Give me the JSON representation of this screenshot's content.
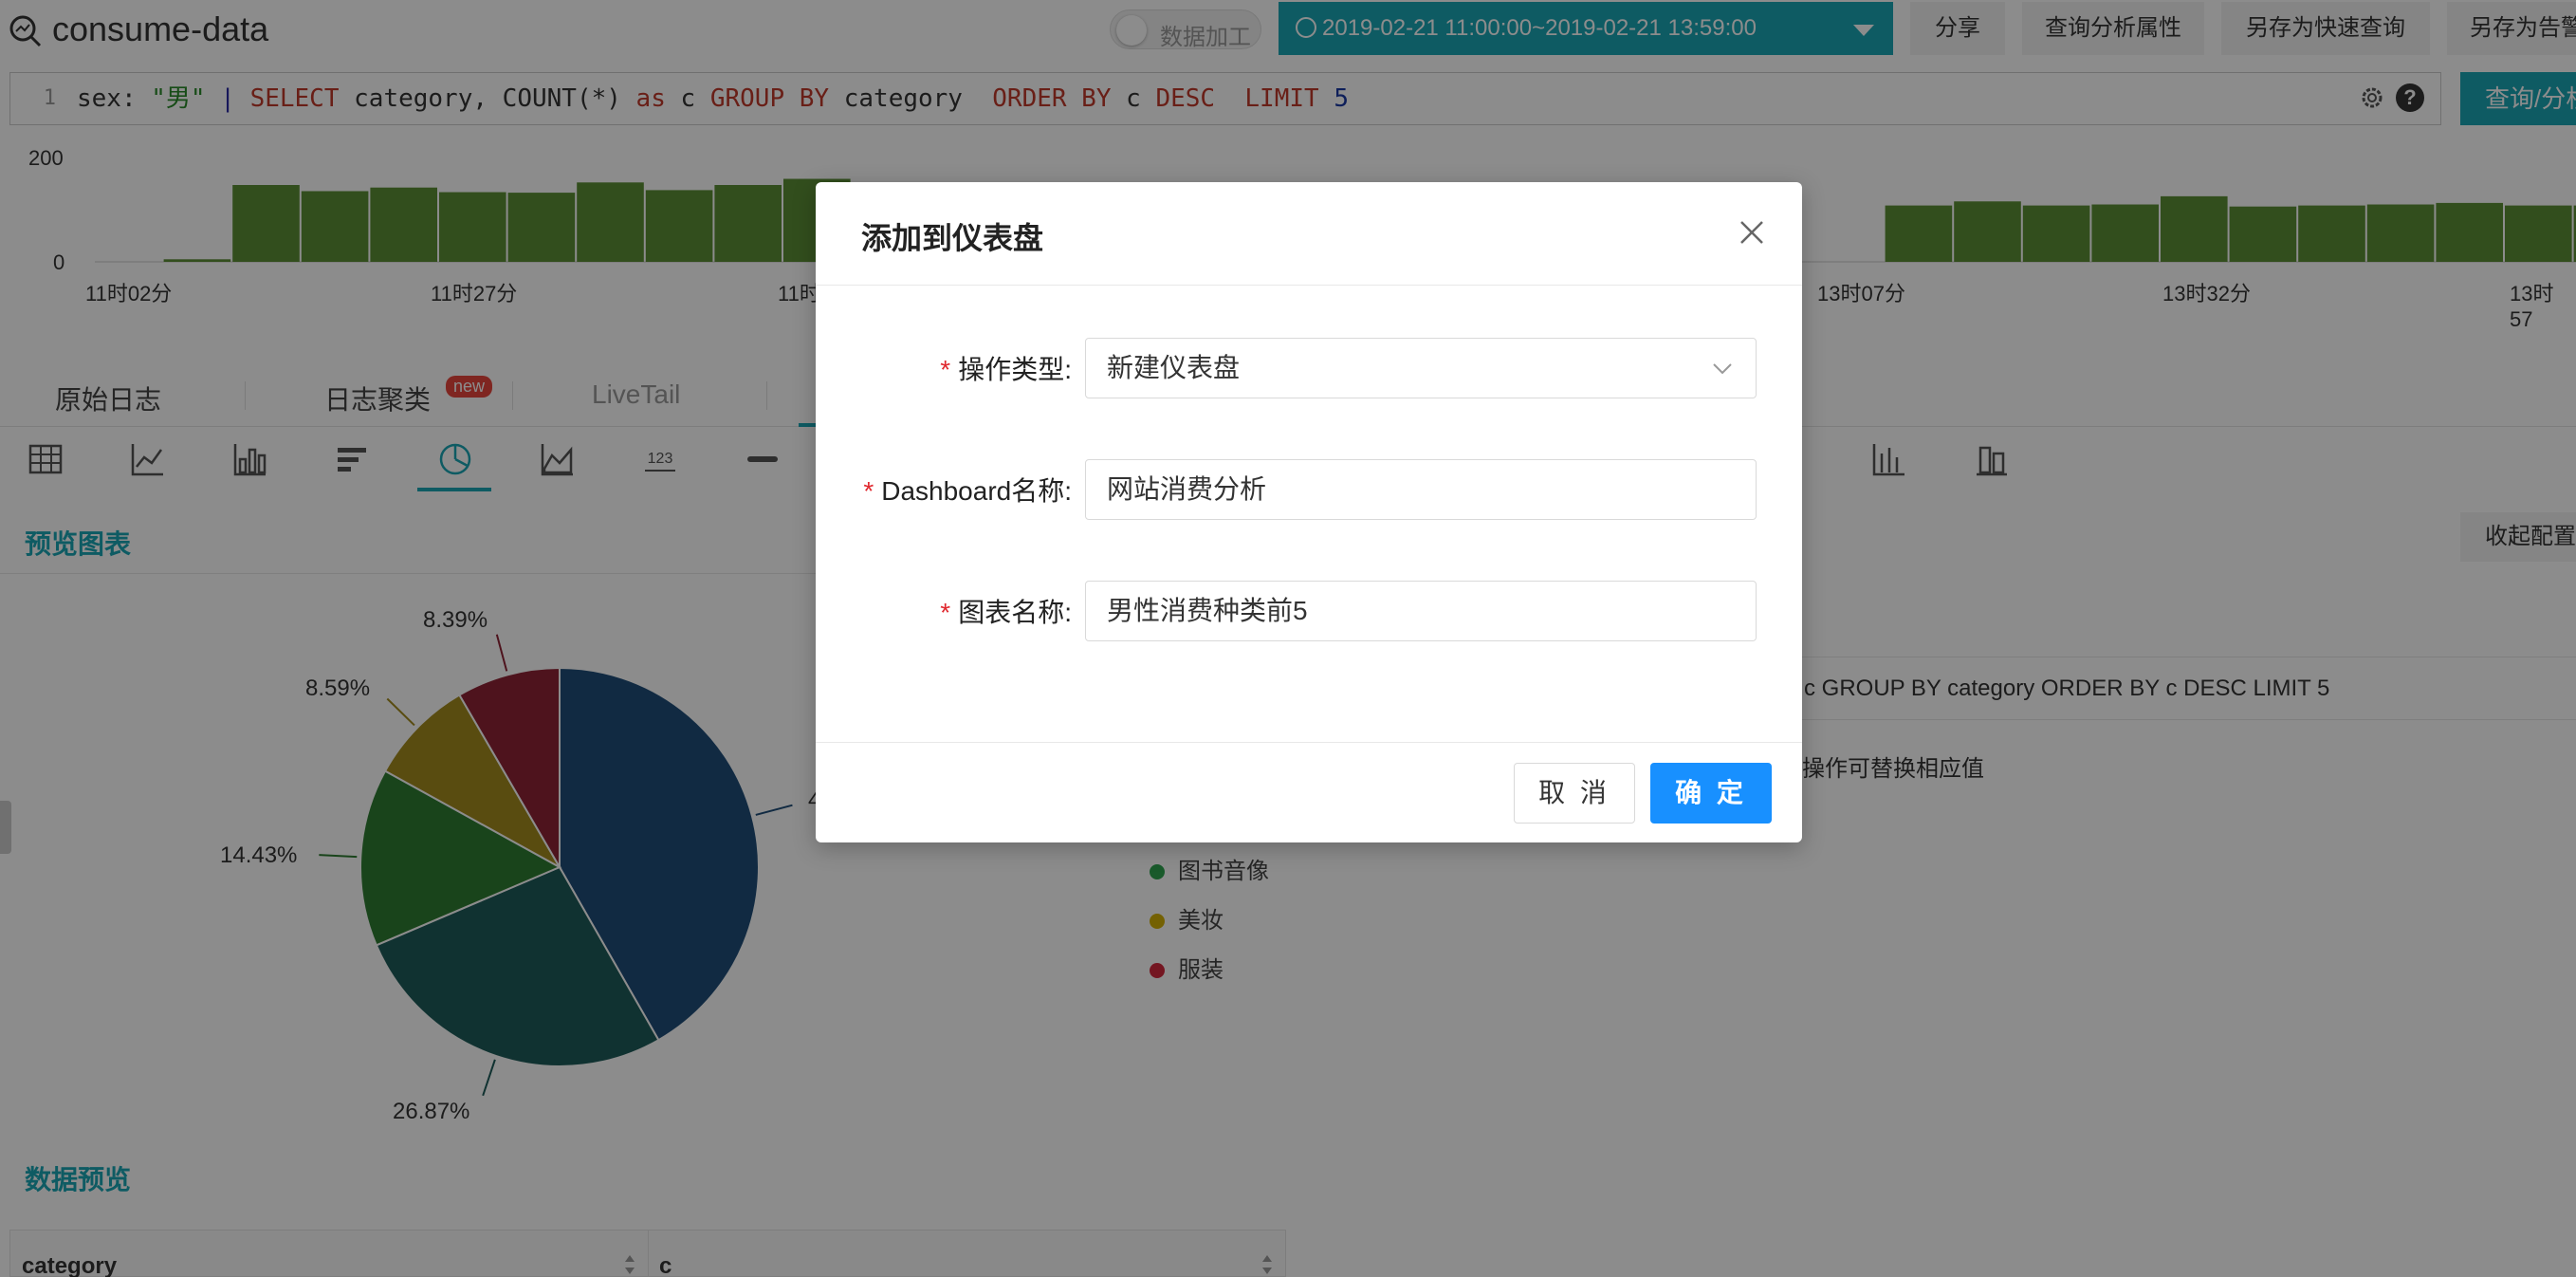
{
  "header": {
    "app_title": "consume-data",
    "toggle_label": "数据加工",
    "time_range": "2019-02-21 11:00:00~2019-02-21 13:59:00",
    "buttons": [
      "分享",
      "查询分析属性",
      "另存为快速查询",
      "另存为告警"
    ]
  },
  "query": {
    "line_number": "1",
    "tokens": {
      "field": "sex: ",
      "value": "\"男\"",
      "pipe": " | ",
      "select": "SELECT",
      "sel_cols": " category, ",
      "count_fn": "COUNT(*)",
      "as_kw": " as",
      "alias": " c ",
      "group_kw": "GROUP BY",
      "group_col": " category  ",
      "order_kw": "ORDER BY",
      "order_col": " c ",
      "desc_kw": "DESC",
      "limit_kw": "  LIMIT",
      "limit_val": " 5"
    },
    "submit_label": "查询/分析"
  },
  "histogram": {
    "y_ticks": [
      "200",
      "0"
    ],
    "x_ticks": [
      "11时02分",
      "11时27分",
      "11时",
      "13时07分",
      "13时32分",
      "13时57"
    ],
    "ymax": 200,
    "values": [
      0,
      5,
      150,
      138,
      145,
      136,
      135,
      155,
      140,
      150,
      162,
      0,
      0,
      0,
      0,
      0,
      0,
      0,
      0,
      0,
      0,
      0,
      0,
      0,
      0,
      0,
      110,
      118,
      110,
      112,
      128,
      108,
      110,
      112,
      115,
      110,
      110,
      82
    ],
    "bar_color": "#5b8f35"
  },
  "tabs": {
    "items": [
      "原始日志",
      "日志聚类",
      "LiveTail"
    ],
    "badge": "new"
  },
  "preview": {
    "chart_title": "预览图表",
    "collapse_label": "收起配置",
    "data_title": "数据预览",
    "sql_echo": "c GROUP BY category ORDER BY c DESC LIMIT 5",
    "hint": "操作可替换相应值",
    "table_headers": [
      "category",
      "c"
    ]
  },
  "chart_data": {
    "type": "pie",
    "slices": [
      {
        "label": "",
        "value": 41.72,
        "color": "#1f4e79"
      },
      {
        "label": "",
        "value": 26.87,
        "color": "#1e5c5a"
      },
      {
        "label": "图书音像",
        "value": 14.43,
        "color": "#2e7d32"
      },
      {
        "label": "美妆",
        "value": 8.59,
        "color": "#a38a1e"
      },
      {
        "label": "服装",
        "value": 8.39,
        "color": "#8e2435"
      }
    ],
    "value_labels": [
      "8.39%",
      "8.59%",
      "14.43%",
      "26.87%",
      "4"
    ]
  },
  "legend": [
    {
      "label": "图书音像",
      "color": "#2ea44f"
    },
    {
      "label": "美妆",
      "color": "#d4b106"
    },
    {
      "label": "服装",
      "color": "#d4293d"
    }
  ],
  "modal": {
    "title": "添加到仪表盘",
    "required_mark": "*",
    "fields": [
      {
        "label": "操作类型",
        "value": "新建仪表盘"
      },
      {
        "label": "Dashboard名称",
        "value": "网站消费分析"
      },
      {
        "label": "图表名称",
        "value": "男性消费种类前5"
      }
    ],
    "cancel_label": "取 消",
    "ok_label": "确 定"
  }
}
